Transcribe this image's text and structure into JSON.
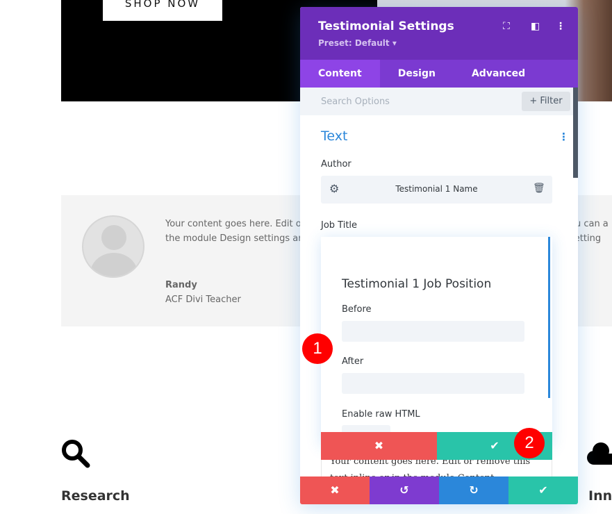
{
  "hero": {
    "shop_label": "SHOP NOW"
  },
  "testimonial": {
    "text_left_1": "Your content goes here. Edit o",
    "text_left_2": "the module Design settings ar",
    "text_right_1": "ou can a",
    "text_right_2": "setting",
    "author": "Randy",
    "job": "ACF Divi Teacher"
  },
  "panel": {
    "title": "Testimonial Settings",
    "preset": "Preset: Default ▾",
    "tabs": [
      "Content",
      "Design",
      "Advanced"
    ],
    "search_placeholder": "Search Options",
    "filter_label": "+ Filter",
    "section_title": "Text",
    "author_label": "Author",
    "author_value": "Testimonial 1 Name",
    "job_title_label": "Job Title"
  },
  "popup": {
    "title": "Testimonial 1 Job Position",
    "before_label": "Before",
    "after_label": "After",
    "raw_html_label": "Enable raw HTML"
  },
  "behind_text": {
    "line1": "Your content goes here. Edit or remove this",
    "line2": "text inline or in the module Content"
  },
  "badges": {
    "one": "1",
    "two": "2"
  },
  "features": {
    "research": "Research",
    "inn": "Inn"
  },
  "colors": {
    "purple": "#6c2eb9",
    "tab": "#7b3ad1",
    "red": "#ef5555",
    "green": "#29c4a9",
    "blue": "#2b87da",
    "undo": "#7e3bd0"
  }
}
